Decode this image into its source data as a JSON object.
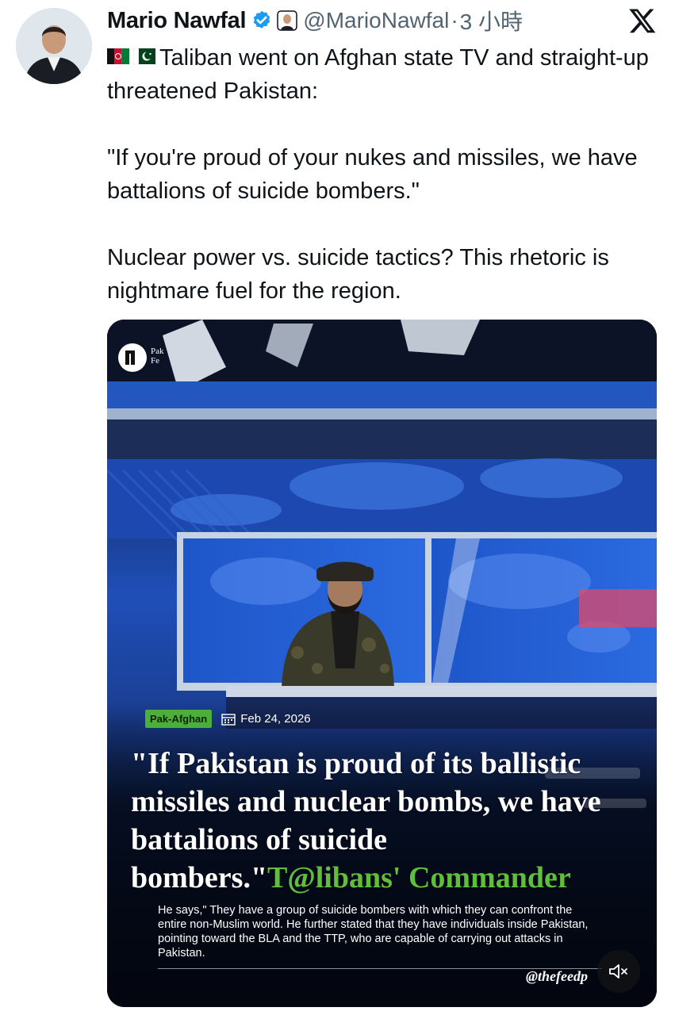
{
  "author": {
    "name": "Mario Nawfal",
    "handle": "@MarioNawfal",
    "separator": "·",
    "time": "3 小時"
  },
  "tweet": {
    "flags": [
      "afghanistan-flag",
      "pakistan-flag"
    ],
    "line1": "Taliban went on Afghan state TV and straight-up threatened Pakistan:",
    "line2": "\"If you're proud of your nukes and missiles, we have battalions of suicide bombers.\"",
    "line3": "Nuclear power vs. suicide tactics? This rhetoric is nightmare fuel for the region."
  },
  "media": {
    "tag": "Pak-Afghan",
    "date": "Feb 24, 2026",
    "quote_white": "\"If Pakistan is proud of its ballistic missiles and nuclear bombs, we have battalions of suicide bombers.\"",
    "quote_green": "T@libans' Commander",
    "caption": "He says,\" They have a group of suicide bombers with which they can confront the entire non-Muslim world. He further stated that they have individuals inside Pakistan, pointing toward the BLA and the TTP, who are capable of carrying out attacks in Pakistan.",
    "watermark": "@thefeedp",
    "logo_text": "Pak Fe",
    "mute_icon": "speaker-muted-icon"
  },
  "colors": {
    "text": "#0f1419",
    "secondary": "#536471",
    "verified": "#1d9bf0",
    "tag_green": "#4caf3a",
    "quote_green": "#5fbf3c"
  }
}
